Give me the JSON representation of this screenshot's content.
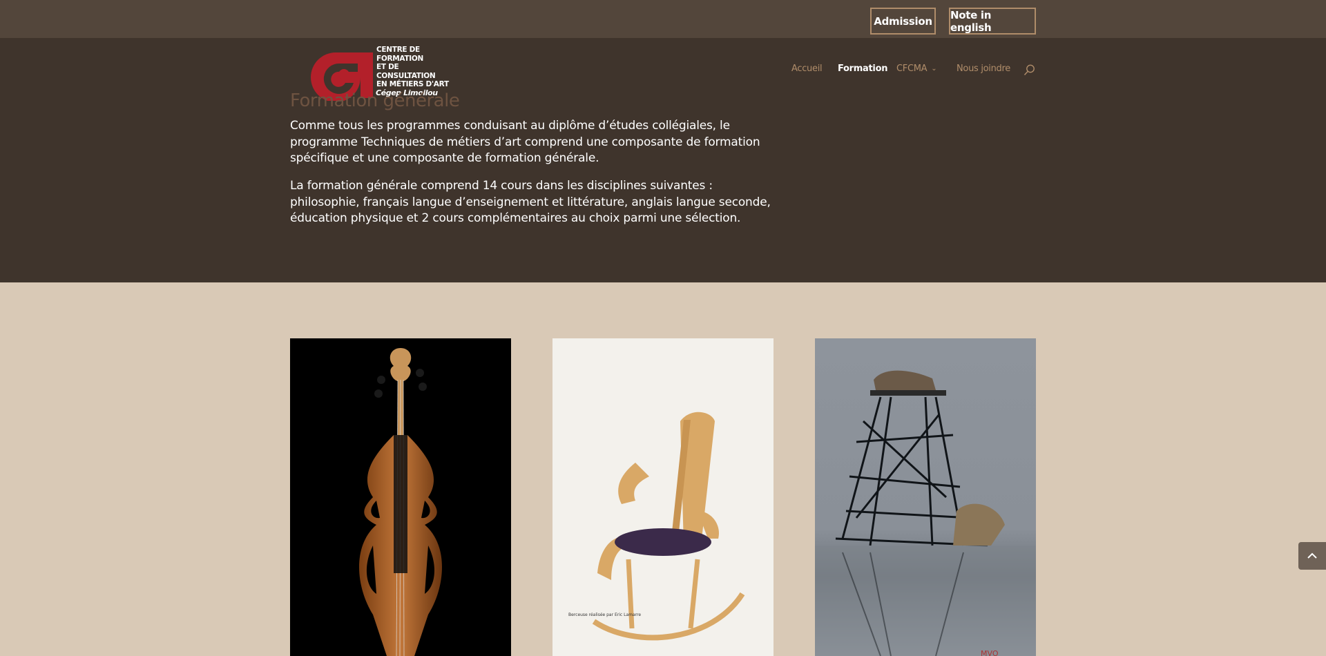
{
  "topbar": {
    "admission_label": "Admission",
    "english_label": "Note in english"
  },
  "logo": {
    "line1": "CENTRE DE FORMATION",
    "line2": "ET DE CONSULTATION",
    "line3": "EN MÉTIERS D'ART",
    "sub": "Cégep Limoilou"
  },
  "nav": {
    "items": [
      {
        "label": "Accueil",
        "active": false
      },
      {
        "label": "Formation",
        "active": true
      },
      {
        "label": "CFCMA",
        "active": false,
        "has_submenu": true
      },
      {
        "label": "Nous joindre",
        "active": false
      }
    ],
    "search_icon": "search-icon"
  },
  "content": {
    "title": "Formation générale",
    "paragraph1": "Comme tous les programmes conduisant au diplôme d’études collégiales, le programme Techniques de métiers d’art comprend une composante de formation spécifique et une composante de formation générale.",
    "paragraph2": "La formation générale comprend 14 cours dans les disciplines suivantes : philosophie, français langue d’enseignement et littérature, anglais langue seconde, éducation physique et 2 cours complémentaires au choix parmi une sélection."
  },
  "gallery": {
    "chair_caption": "Berceuse réalisée par Eric Lamarre",
    "sculpture_mark": "MVO"
  },
  "colors": {
    "topbar_bg": "#53463b",
    "hero_bg": "#3f342c",
    "page_bg": "#d9c9b6",
    "accent": "#b08d6a",
    "logo_red": "#b3202a"
  }
}
